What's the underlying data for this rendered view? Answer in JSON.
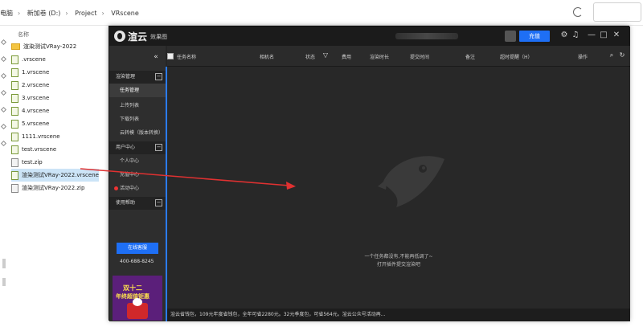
{
  "explorer": {
    "breadcrumb": [
      "电脑",
      "新加卷 (D:)",
      "Project",
      "VRscene"
    ],
    "column_header": "名称",
    "files": [
      {
        "name": "渲染测试VRay-2022",
        "type": "folder"
      },
      {
        "name": ".vrscene",
        "type": "vrscene"
      },
      {
        "name": "1.vrscene",
        "type": "vrscene"
      },
      {
        "name": "2.vrscene",
        "type": "vrscene"
      },
      {
        "name": "3.vrscene",
        "type": "vrscene"
      },
      {
        "name": "4.vrscene",
        "type": "vrscene"
      },
      {
        "name": "5.vrscene",
        "type": "vrscene"
      },
      {
        "name": "1111.vrscene",
        "type": "vrscene"
      },
      {
        "name": "test.vrscene",
        "type": "vrscene"
      },
      {
        "name": "test.zip",
        "type": "zip"
      },
      {
        "name": "渲染测试VRay-2022.vrscene",
        "type": "vrscene",
        "selected": true
      },
      {
        "name": "渲染测试VRay-2022.zip",
        "type": "zip"
      }
    ]
  },
  "app": {
    "brand": "渲云",
    "brand_sub": "效果图",
    "recharge_label": "充值",
    "title_icons": [
      "gear-icon",
      "bell-icon",
      "minimize-icon",
      "maximize-icon",
      "close-icon"
    ],
    "table_headers": {
      "task_name": "任务名称",
      "camera": "相机名",
      "status": "状态",
      "cost": "费用",
      "render_time": "渲染时长",
      "submit_time": "提交时间",
      "note": "备注",
      "timeout": "超时提醒（H）",
      "actions": "操作"
    },
    "sidebar": {
      "groups": [
        {
          "label": "渲染管理",
          "items": [
            "任务管理",
            "上传列表",
            "下载列表",
            "云转模（版本转换）"
          ]
        },
        {
          "label": "用户中心",
          "items": [
            "个人中心",
            "充值中心",
            "活动中心"
          ]
        },
        {
          "label": "使用帮助",
          "items": []
        }
      ],
      "online_service": "在线客服",
      "phone": "400-688-8245",
      "promo_line1": "双十二",
      "promo_line2": "年终超值钜惠"
    },
    "empty_line1": "一个任务都没有,不能再低调了~",
    "empty_line2": "打开插件提交渲染吧",
    "status_text": "渲云省钱包，109元年度省钱包，全年可省2280元。32元季度包，可省564元。渲云公众号活动再..."
  },
  "colors": {
    "accent": "#2b7cff",
    "button_blue": "#1e6ff5",
    "arrow_red": "#e03131",
    "app_bg": "#282828"
  }
}
